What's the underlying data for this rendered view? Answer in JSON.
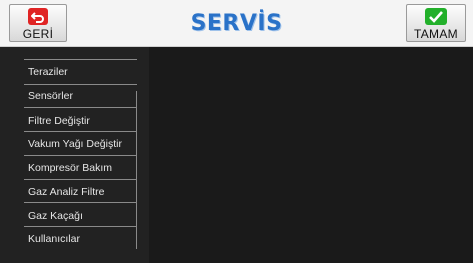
{
  "header": {
    "title": "SERVİS",
    "back_label": "GERİ",
    "ok_label": "TAMAM"
  },
  "icons": {
    "back": "return-arrow-icon",
    "ok": "checkmark-icon"
  },
  "colors": {
    "title": "#2a72c8",
    "back_icon": "#e02424",
    "ok_icon": "#22b02a",
    "background": "#1a1a1a"
  },
  "sidebar": {
    "items": [
      {
        "label": "Teraziler"
      },
      {
        "label": "Sensörler"
      },
      {
        "label": "Filtre Değiştir"
      },
      {
        "label": "Vakum Yağı Değiştir"
      },
      {
        "label": "Kompresör Bakım"
      },
      {
        "label": "Gaz Analiz Filtre"
      },
      {
        "label": "Gaz Kaçağı"
      },
      {
        "label": "Kullanıcılar"
      }
    ]
  }
}
